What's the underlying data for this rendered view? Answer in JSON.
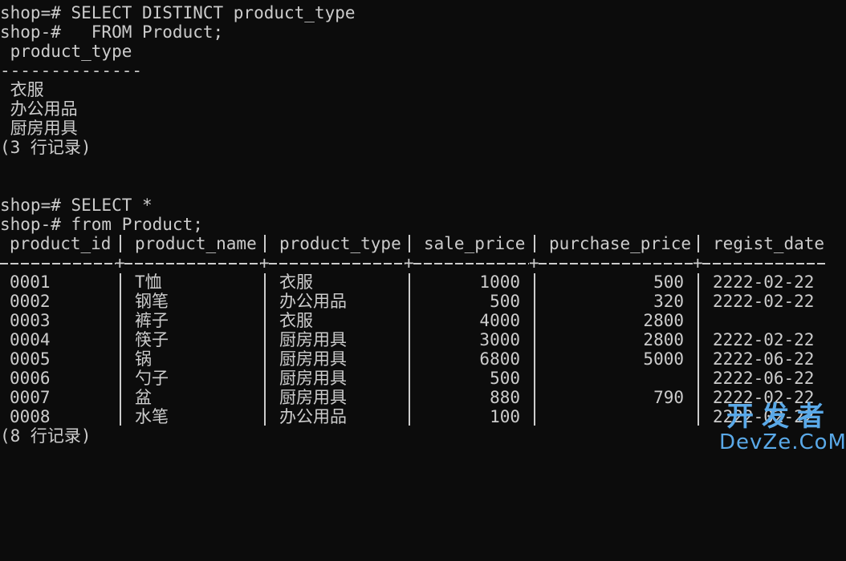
{
  "query1": {
    "line1": "shop=# SELECT DISTINCT product_type",
    "line2": "shop-#   FROM Product;",
    "header": " product_type",
    "separator": "--------------",
    "rows": [
      " 衣服",
      " 办公用品",
      " 厨房用具"
    ],
    "footer": "(3 行记录)"
  },
  "query2": {
    "line1": "shop=# SELECT *",
    "line2": "shop-# from Product;",
    "columns": [
      "product_id",
      "product_name",
      "product_type",
      "sale_price",
      "purchase_price",
      "regist_date"
    ],
    "rows": [
      [
        "0001",
        "T恤",
        "衣服",
        "1000",
        "500",
        "2222-02-22"
      ],
      [
        "0002",
        "钢笔",
        "办公用品",
        "500",
        "320",
        "2222-02-22"
      ],
      [
        "0003",
        "裤子",
        "衣服",
        "4000",
        "2800",
        ""
      ],
      [
        "0004",
        "筷子",
        "厨房用具",
        "3000",
        "2800",
        "2222-02-22"
      ],
      [
        "0005",
        "锅",
        "厨房用具",
        "6800",
        "5000",
        "2222-06-22"
      ],
      [
        "0006",
        "勺子",
        "厨房用具",
        "500",
        "",
        "2222-06-22"
      ],
      [
        "0007",
        "盆",
        "厨房用具",
        "880",
        "790",
        "2222-02-22"
      ],
      [
        "0008",
        "水笔",
        "办公用品",
        "100",
        "",
        "2222-02-22"
      ]
    ],
    "footer": "(8 行记录)"
  },
  "watermark": {
    "cn": "开发者",
    "en": "DevZe.CoM"
  },
  "colors": {
    "background": "#0c0c0c",
    "text": "#cccccc",
    "watermark": "#5aa9e8"
  }
}
